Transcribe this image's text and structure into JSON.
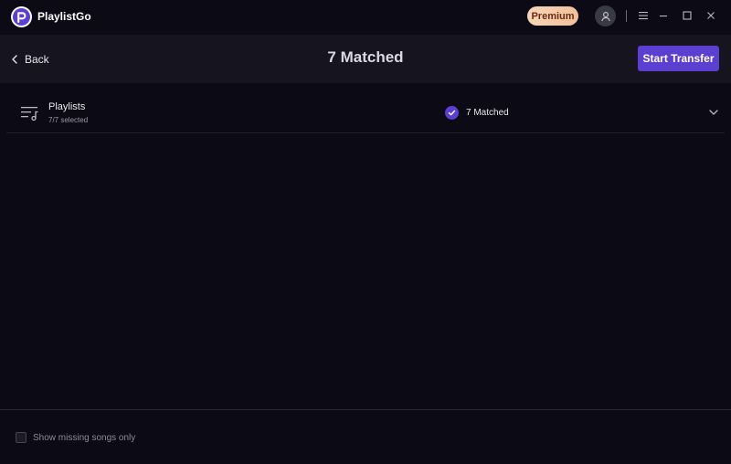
{
  "app": {
    "name": "PlaylistGo"
  },
  "titlebar": {
    "premium_label": "Premium",
    "icons": [
      "user-icon",
      "menu-icon",
      "minimize-icon",
      "maximize-icon",
      "close-icon"
    ]
  },
  "header": {
    "back_label": "Back",
    "title": "7 Matched",
    "start_transfer_label": "Start Transfer"
  },
  "playlist_row": {
    "title": "Playlists",
    "subtitle": "7/7 selected",
    "match_status": "7 Matched",
    "icon": "playlist-icon"
  },
  "footer": {
    "checkbox_label": "Show missing songs only",
    "checked": false
  },
  "colors": {
    "background": "#0b0a15",
    "header_bg": "#15141f",
    "accent": "#5b3fd1",
    "premium": "#f2c09a"
  }
}
